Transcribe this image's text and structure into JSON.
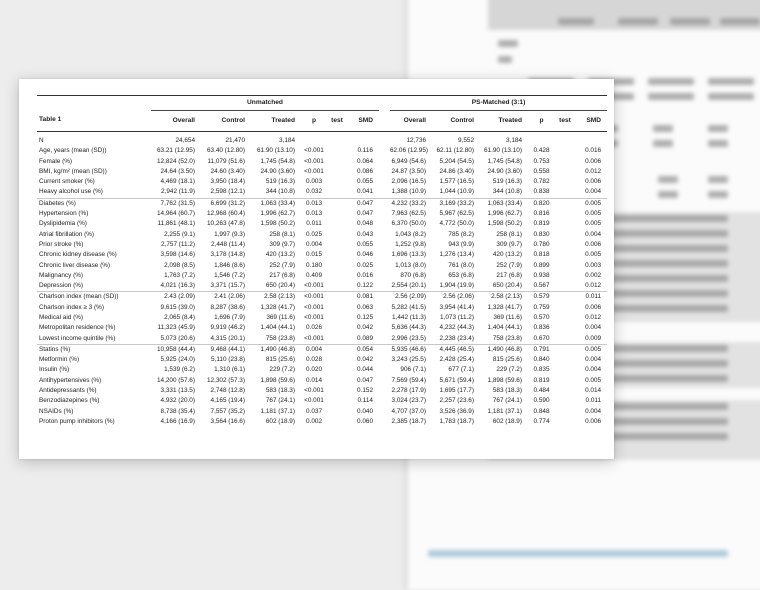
{
  "table": {
    "title": "Table 1",
    "groups": {
      "unmatched": "Unmatched",
      "matched": "PS-Matched (3:1)"
    },
    "columns": [
      "Overall",
      "Control",
      "Treated",
      "p",
      "test",
      "SMD",
      "Overall",
      "Control",
      "Treated",
      "p",
      "test",
      "SMD"
    ],
    "rows": [
      {
        "label": "N",
        "u": [
          "24,654",
          "21,470",
          "3,184",
          "",
          "",
          ""
        ],
        "m": [
          "12,736",
          "9,552",
          "3,184",
          "",
          "",
          ""
        ]
      },
      {
        "label": "Age, years (mean (SD))",
        "u": [
          "63.21 (12.95)",
          "63.40 (12.80)",
          "61.90 (13.10)",
          "<0.001",
          "",
          "0.116"
        ],
        "m": [
          "62.06 (12.95)",
          "62.11 (12.80)",
          "61.90 (13.10)",
          "0.428",
          "",
          "0.016"
        ]
      },
      {
        "label": "Female (%)",
        "u": [
          "12,824 (52.0)",
          "11,079 (51.6)",
          "1,745 (54.8)",
          "<0.001",
          "",
          "0.064"
        ],
        "m": [
          "6,949 (54.6)",
          "5,204 (54.5)",
          "1,745 (54.8)",
          "0.753",
          "",
          "0.006"
        ]
      },
      {
        "label": "BMI, kg/m² (mean (SD))",
        "u": [
          "24.64 (3.50)",
          "24.60 (3.40)",
          "24.90 (3.60)",
          "<0.001",
          "",
          "0.086"
        ],
        "m": [
          "24.87 (3.50)",
          "24.86 (3.40)",
          "24.90 (3.60)",
          "0.558",
          "",
          "0.012"
        ]
      },
      {
        "label": "Current smoker (%)",
        "u": [
          "4,469 (18.1)",
          "3,950 (18.4)",
          "519 (16.3)",
          "0.003",
          "",
          "0.055"
        ],
        "m": [
          "2,096 (16.5)",
          "1,577 (16.5)",
          "519 (16.3)",
          "0.782",
          "",
          "0.006"
        ]
      },
      {
        "label": "Heavy alcohol use (%)",
        "u": [
          "2,942 (11.9)",
          "2,598 (12.1)",
          "344 (10.8)",
          "0.032",
          "",
          "0.041"
        ],
        "m": [
          "1,388 (10.9)",
          "1,044 (10.9)",
          "344 (10.8)",
          "0.838",
          "",
          "0.004"
        ]
      },
      {
        "label": "Diabetes (%)",
        "sep": true,
        "u": [
          "7,762 (31.5)",
          "6,699 (31.2)",
          "1,063 (33.4)",
          "0.013",
          "",
          "0.047"
        ],
        "m": [
          "4,232 (33.2)",
          "3,169 (33.2)",
          "1,063 (33.4)",
          "0.820",
          "",
          "0.005"
        ]
      },
      {
        "label": "Hypertension (%)",
        "u": [
          "14,964 (60.7)",
          "12,968 (60.4)",
          "1,996 (62.7)",
          "0.013",
          "",
          "0.047"
        ],
        "m": [
          "7,963 (62.5)",
          "5,967 (62.5)",
          "1,996 (62.7)",
          "0.816",
          "",
          "0.005"
        ]
      },
      {
        "label": "Dyslipidemia (%)",
        "u": [
          "11,861 (48.1)",
          "10,263 (47.8)",
          "1,598 (50.2)",
          "0.011",
          "",
          "0.048"
        ],
        "m": [
          "6,370 (50.0)",
          "4,772 (50.0)",
          "1,598 (50.2)",
          "0.819",
          "",
          "0.005"
        ]
      },
      {
        "label": "Atrial fibrillation (%)",
        "u": [
          "2,255 (9.1)",
          "1,997 (9.3)",
          "258 (8.1)",
          "0.025",
          "",
          "0.043"
        ],
        "m": [
          "1,043 (8.2)",
          "785 (8.2)",
          "258 (8.1)",
          "0.830",
          "",
          "0.004"
        ]
      },
      {
        "label": "Prior stroke (%)",
        "u": [
          "2,757 (11.2)",
          "2,448 (11.4)",
          "309 (9.7)",
          "0.004",
          "",
          "0.055"
        ],
        "m": [
          "1,252 (9.8)",
          "943 (9.9)",
          "309 (9.7)",
          "0.780",
          "",
          "0.006"
        ]
      },
      {
        "label": "Chronic kidney disease (%)",
        "u": [
          "3,598 (14.6)",
          "3,178 (14.8)",
          "420 (13.2)",
          "0.015",
          "",
          "0.046"
        ],
        "m": [
          "1,696 (13.3)",
          "1,276 (13.4)",
          "420 (13.2)",
          "0.818",
          "",
          "0.005"
        ]
      },
      {
        "label": "Chronic liver disease (%)",
        "u": [
          "2,098 (8.5)",
          "1,846 (8.6)",
          "252 (7.9)",
          "0.180",
          "",
          "0.025"
        ],
        "m": [
          "1,013 (8.0)",
          "761 (8.0)",
          "252 (7.9)",
          "0.899",
          "",
          "0.003"
        ]
      },
      {
        "label": "Malignancy (%)",
        "u": [
          "1,763 (7.2)",
          "1,546 (7.2)",
          "217 (6.8)",
          "0.409",
          "",
          "0.016"
        ],
        "m": [
          "870 (6.8)",
          "653 (6.8)",
          "217 (6.8)",
          "0.938",
          "",
          "0.002"
        ]
      },
      {
        "label": "Depression (%)",
        "u": [
          "4,021 (16.3)",
          "3,371 (15.7)",
          "650 (20.4)",
          "<0.001",
          "",
          "0.122"
        ],
        "m": [
          "2,554 (20.1)",
          "1,904 (19.9)",
          "650 (20.4)",
          "0.567",
          "",
          "0.012"
        ]
      },
      {
        "label": "Charlson index (mean (SD))",
        "sep": true,
        "u": [
          "2.43 (2.09)",
          "2.41 (2.06)",
          "2.58 (2.13)",
          "<0.001",
          "",
          "0.081"
        ],
        "m": [
          "2.56 (2.09)",
          "2.56 (2.06)",
          "2.58 (2.13)",
          "0.579",
          "",
          "0.011"
        ]
      },
      {
        "label": "Charlson index ≥ 3 (%)",
        "u": [
          "9,615 (39.0)",
          "8,287 (38.6)",
          "1,328 (41.7)",
          "<0.001",
          "",
          "0.063"
        ],
        "m": [
          "5,282 (41.5)",
          "3,954 (41.4)",
          "1,328 (41.7)",
          "0.759",
          "",
          "0.006"
        ]
      },
      {
        "label": "Medical aid (%)",
        "u": [
          "2,065 (8.4)",
          "1,696 (7.9)",
          "369 (11.6)",
          "<0.001",
          "",
          "0.125"
        ],
        "m": [
          "1,442 (11.3)",
          "1,073 (11.2)",
          "369 (11.6)",
          "0.570",
          "",
          "0.012"
        ]
      },
      {
        "label": "Metropolitan residence (%)",
        "u": [
          "11,323 (45.9)",
          "9,919 (46.2)",
          "1,404 (44.1)",
          "0.026",
          "",
          "0.042"
        ],
        "m": [
          "5,636 (44.3)",
          "4,232 (44.3)",
          "1,404 (44.1)",
          "0.836",
          "",
          "0.004"
        ]
      },
      {
        "label": "Lowest income quintile (%)",
        "u": [
          "5,073 (20.6)",
          "4,315 (20.1)",
          "758 (23.8)",
          "<0.001",
          "",
          "0.089"
        ],
        "m": [
          "2,996 (23.5)",
          "2,238 (23.4)",
          "758 (23.8)",
          "0.670",
          "",
          "0.009"
        ]
      },
      {
        "label": "Statins (%)",
        "sep": true,
        "u": [
          "10,958 (44.4)",
          "9,468 (44.1)",
          "1,490 (46.8)",
          "0.004",
          "",
          "0.054"
        ],
        "m": [
          "5,935 (46.6)",
          "4,445 (46.5)",
          "1,490 (46.8)",
          "0.791",
          "",
          "0.005"
        ]
      },
      {
        "label": "Metformin (%)",
        "u": [
          "5,925 (24.0)",
          "5,110 (23.8)",
          "815 (25.6)",
          "0.028",
          "",
          "0.042"
        ],
        "m": [
          "3,243 (25.5)",
          "2,428 (25.4)",
          "815 (25.6)",
          "0.840",
          "",
          "0.004"
        ]
      },
      {
        "label": "Insulin (%)",
        "u": [
          "1,539 (6.2)",
          "1,310 (6.1)",
          "229 (7.2)",
          "0.020",
          "",
          "0.044"
        ],
        "m": [
          "906 (7.1)",
          "677 (7.1)",
          "229 (7.2)",
          "0.835",
          "",
          "0.004"
        ]
      },
      {
        "label": "Antihypertensives (%)",
        "u": [
          "14,200 (57.6)",
          "12,302 (57.3)",
          "1,898 (59.6)",
          "0.014",
          "",
          "0.047"
        ],
        "m": [
          "7,569 (59.4)",
          "5,671 (59.4)",
          "1,898 (59.6)",
          "0.819",
          "",
          "0.005"
        ]
      },
      {
        "label": "Antidepressants (%)",
        "u": [
          "3,331 (13.5)",
          "2,748 (12.8)",
          "583 (18.3)",
          "<0.001",
          "",
          "0.152"
        ],
        "m": [
          "2,278 (17.9)",
          "1,695 (17.7)",
          "583 (18.3)",
          "0.484",
          "",
          "0.014"
        ]
      },
      {
        "label": "Benzodiazepines (%)",
        "u": [
          "4,932 (20.0)",
          "4,165 (19.4)",
          "767 (24.1)",
          "<0.001",
          "",
          "0.114"
        ],
        "m": [
          "3,024 (23.7)",
          "2,257 (23.6)",
          "767 (24.1)",
          "0.590",
          "",
          "0.011"
        ]
      },
      {
        "label": "NSAIDs (%)",
        "u": [
          "8,738 (35.4)",
          "7,557 (35.2)",
          "1,181 (37.1)",
          "0.037",
          "",
          "0.040"
        ],
        "m": [
          "4,707 (37.0)",
          "3,526 (36.9)",
          "1,181 (37.1)",
          "0.848",
          "",
          "0.004"
        ]
      },
      {
        "label": "Proton pump inhibitors (%)",
        "u": [
          "4,166 (16.9)",
          "3,564 (16.6)",
          "602 (18.9)",
          "0.002",
          "",
          "0.060"
        ],
        "m": [
          "2,385 (18.7)",
          "1,783 (18.7)",
          "602 (18.9)",
          "0.774",
          "",
          "0.006"
        ]
      }
    ]
  }
}
